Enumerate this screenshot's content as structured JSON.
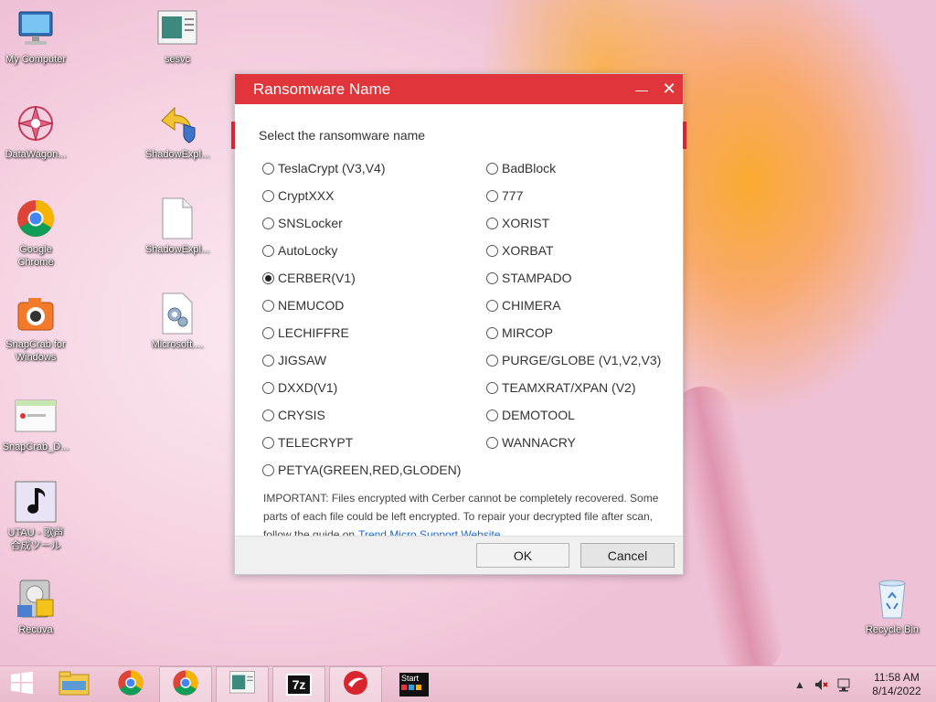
{
  "desktop": {
    "icons_left": [
      {
        "label": "My Computer"
      },
      {
        "label": "DataWagon..."
      },
      {
        "label": "Google Chrome"
      },
      {
        "label": "SnapCrab for Windows"
      },
      {
        "label": "SnapCrab_D..."
      },
      {
        "label": "UTAU - 歌声合成ツール"
      },
      {
        "label": "Recuva"
      }
    ],
    "icons_second": [
      {
        "label": "sesvc"
      },
      {
        "label": "ShadowExpl..."
      },
      {
        "label": "ShadowExpl..."
      },
      {
        "label": "Microsoft...."
      }
    ],
    "recycle_bin": {
      "label": "Recycle Bin"
    }
  },
  "dialog": {
    "title": "Ransomware Name",
    "minimize_glyph": "—",
    "close_glyph": "✕",
    "prompt": "Select the ransomware name",
    "options_left": [
      {
        "label": "TeslaCrypt (V3,V4)",
        "checked": false
      },
      {
        "label": "CryptXXX",
        "checked": false
      },
      {
        "label": "SNSLocker",
        "checked": false
      },
      {
        "label": "AutoLocky",
        "checked": false
      },
      {
        "label": "CERBER(V1)",
        "checked": true
      },
      {
        "label": "NEMUCOD",
        "checked": false
      },
      {
        "label": "LECHIFFRE",
        "checked": false
      },
      {
        "label": "JIGSAW",
        "checked": false
      },
      {
        "label": "DXXD(V1)",
        "checked": false
      },
      {
        "label": "CRYSIS",
        "checked": false
      },
      {
        "label": "TELECRYPT",
        "checked": false
      },
      {
        "label": "PETYA(GREEN,RED,GLODEN)",
        "checked": false
      }
    ],
    "options_right": [
      {
        "label": "BadBlock",
        "checked": false
      },
      {
        "label": "777",
        "checked": false
      },
      {
        "label": "XORIST",
        "checked": false
      },
      {
        "label": "XORBAT",
        "checked": false
      },
      {
        "label": "STAMPADO",
        "checked": false
      },
      {
        "label": "CHIMERA",
        "checked": false
      },
      {
        "label": "MIRCOP",
        "checked": false
      },
      {
        "label": "PURGE/GLOBE (V1,V2,V3)",
        "checked": false
      },
      {
        "label": "TEAMXRAT/XPAN (V2)",
        "checked": false
      },
      {
        "label": "DEMOTOOL",
        "checked": false
      },
      {
        "label": "WANNACRY",
        "checked": false
      }
    ],
    "notice_text": "IMPORTANT: Files encrypted with Cerber cannot be completely recovered. Some parts of each file could be left encrypted. To repair your decrypted file after scan, follow the guide on",
    "notice_link": "Trend Micro Support Website",
    "ok_label": "OK",
    "cancel_label": "Cancel"
  },
  "taskbar": {
    "start_icon": "windows-logo-icon",
    "cmd_label": "Start",
    "sevenzip_label": "7z",
    "time": "11:58 AM",
    "date": "8/14/2022"
  },
  "colors": {
    "dialog_title_bg": "#e0353b",
    "link": "#1a66cc"
  }
}
